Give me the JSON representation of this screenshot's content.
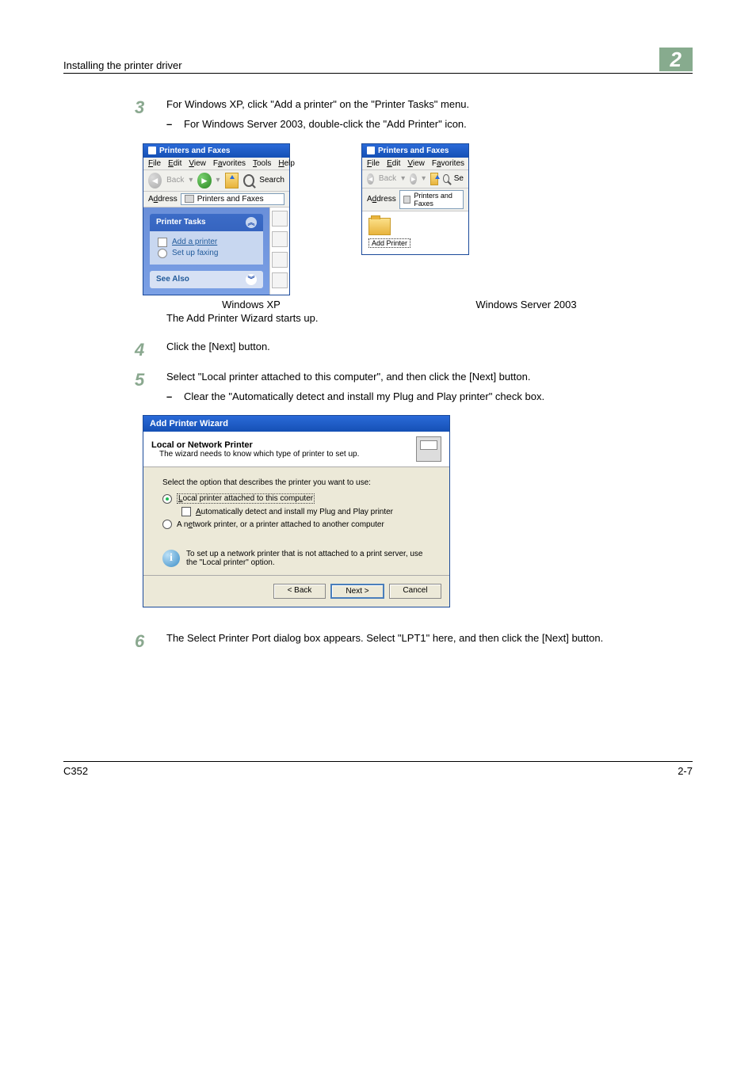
{
  "header": {
    "title": "Installing the printer driver",
    "chapter": "2"
  },
  "step3": {
    "num": "3",
    "text": "For Windows XP, click \"Add a printer\" on the \"Printer Tasks\" menu.",
    "sub": "For Windows Server 2003, double-click the \"Add Printer\" icon."
  },
  "xpWindow": {
    "title": "Printers and Faxes",
    "menu": {
      "file": "File",
      "edit": "Edit",
      "view": "View",
      "favorites": "Favorites",
      "tools": "Tools",
      "help": "Help"
    },
    "back": "Back",
    "search": "Search",
    "addressLabel": "Address",
    "addressValue": "Printers and Faxes",
    "printerTasks": "Printer Tasks",
    "addPrinter": "Add a printer",
    "setupFax": "Set up faxing",
    "seeAlso": "See Also"
  },
  "svWindow": {
    "title": "Printers and Faxes",
    "menu": {
      "file": "File",
      "edit": "Edit",
      "view": "View",
      "favorites": "Favorites"
    },
    "back": "Back",
    "se": "Se",
    "addressLabel": "Address",
    "addressValue": "Printers and Faxes",
    "addPrinter": "Add Printer"
  },
  "captions": {
    "xp": "Windows XP",
    "server": "Windows Server 2003",
    "startup": "The Add Printer Wizard starts up."
  },
  "step4": {
    "num": "4",
    "text": "Click the [Next] button."
  },
  "step5": {
    "num": "5",
    "text": "Select \"Local printer attached to this computer\", and then click the [Next] button.",
    "sub": "Clear the \"Automatically detect and install my Plug and Play printer\" check box."
  },
  "wizard": {
    "title": "Add Printer Wizard",
    "heading": "Local or Network Printer",
    "subheading": "The wizard needs to know which type of printer to set up.",
    "prompt": "Select the option that describes the printer you want to use:",
    "optLocalPre": "L",
    "optLocal": "ocal printer attached to this computer",
    "optAutoPre": "A",
    "optAuto": "utomatically detect and install my Plug and Play printer",
    "optNetPre": "A n",
    "optNetU": "e",
    "optNet": "twork printer, or a printer attached to another computer",
    "info": "To set up a network printer that is not attached to a print server, use the \"Local printer\" option.",
    "backBtn": "< Back",
    "nextBtn": "Next >",
    "cancelBtn": "Cancel"
  },
  "step6": {
    "num": "6",
    "text": "The Select Printer Port dialog box appears. Select \"LPT1\" here, and then click the [Next] button."
  },
  "footer": {
    "left": "C352",
    "right": "2-7"
  }
}
